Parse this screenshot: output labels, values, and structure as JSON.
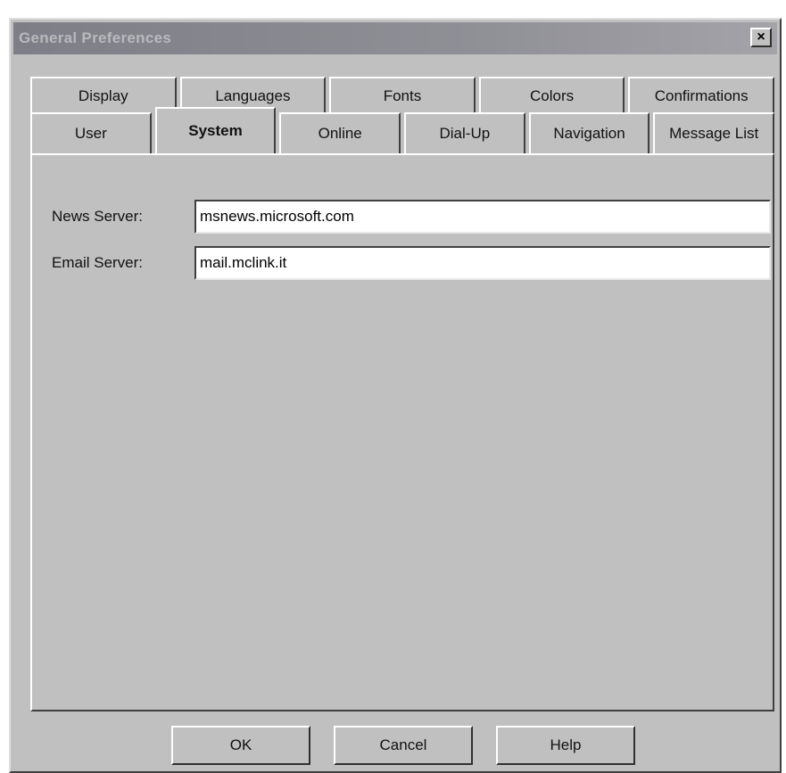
{
  "window": {
    "title": "General Preferences",
    "close_label": "×"
  },
  "tabs": {
    "back_row": [
      "Display",
      "Languages",
      "Fonts",
      "Colors",
      "Confirmations"
    ],
    "front_row": [
      "User",
      "System",
      "Online",
      "Dial-Up",
      "Navigation",
      "Message List"
    ],
    "selected": "System"
  },
  "fields": {
    "news_server": {
      "label": "News Server:",
      "value": "msnews.microsoft.com"
    },
    "email_server": {
      "label": "Email Server:",
      "value": "mail.mclink.it"
    }
  },
  "buttons": {
    "ok": "OK",
    "cancel": "Cancel",
    "help": "Help"
  }
}
